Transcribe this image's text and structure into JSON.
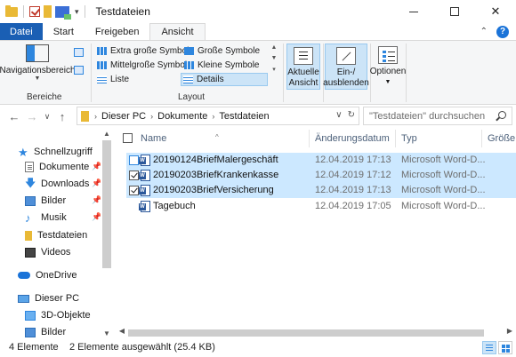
{
  "window": {
    "title": "Testdateien",
    "quick_access_dropdown": "▾"
  },
  "tabs": [
    {
      "label": "Datei"
    },
    {
      "label": "Start"
    },
    {
      "label": "Freigeben"
    },
    {
      "label": "Ansicht"
    }
  ],
  "ribbon": {
    "panes_group": {
      "nav_pane_label": "Navigationsbereich",
      "group_label": "Bereiche"
    },
    "layout_group": {
      "items": [
        {
          "label": "Extra große Symbole"
        },
        {
          "label": "Große Symbole"
        },
        {
          "label": "Mittelgroße Symbole"
        },
        {
          "label": "Kleine Symbole"
        },
        {
          "label": "Liste"
        },
        {
          "label": "Details"
        }
      ],
      "group_label": "Layout"
    },
    "current_view": {
      "sort_label_1": "Aktuelle",
      "sort_label_2": "Ansicht",
      "hide_label_1": "Ein-/",
      "hide_label_2": "ausblenden"
    },
    "options_label": "Optionen"
  },
  "address": {
    "crumbs": [
      "Dieser PC",
      "Dokumente",
      "Testdateien"
    ],
    "search_placeholder": "\"Testdateien\" durchsuchen"
  },
  "nav": {
    "items": [
      {
        "label": "Schnellzugriff"
      },
      {
        "label": "Dokumente"
      },
      {
        "label": "Downloads"
      },
      {
        "label": "Bilder"
      },
      {
        "label": "Musik"
      },
      {
        "label": "Testdateien"
      },
      {
        "label": "Videos"
      },
      {
        "label": "OneDrive"
      },
      {
        "label": "Dieser PC"
      },
      {
        "label": "3D-Objekte"
      },
      {
        "label": "Bilder"
      }
    ]
  },
  "columns": {
    "name": "Name",
    "date": "Änderungsdatum",
    "type": "Typ",
    "size": "Größe"
  },
  "files": [
    {
      "name": "20190124BriefMalergeschäft",
      "date": "12.04.2019 17:13",
      "type": "Microsoft Word-D...",
      "checked": false,
      "selected": true
    },
    {
      "name": "20190203BriefKrankenkasse",
      "date": "12.04.2019 17:12",
      "type": "Microsoft Word-D...",
      "checked": true,
      "selected": true
    },
    {
      "name": "20190203BriefVersicherung",
      "date": "12.04.2019 17:13",
      "type": "Microsoft Word-D...",
      "checked": true,
      "selected": true
    },
    {
      "name": "Tagebuch",
      "date": "12.04.2019 17:05",
      "type": "Microsoft Word-D...",
      "checked": false,
      "selected": false
    }
  ],
  "status": {
    "count": "4 Elemente",
    "selection": "2 Elemente ausgewählt (25.4 KB)"
  },
  "colors": {
    "accent": "#1a5fb4",
    "selection": "#cce8ff",
    "folder": "#e9b936"
  }
}
